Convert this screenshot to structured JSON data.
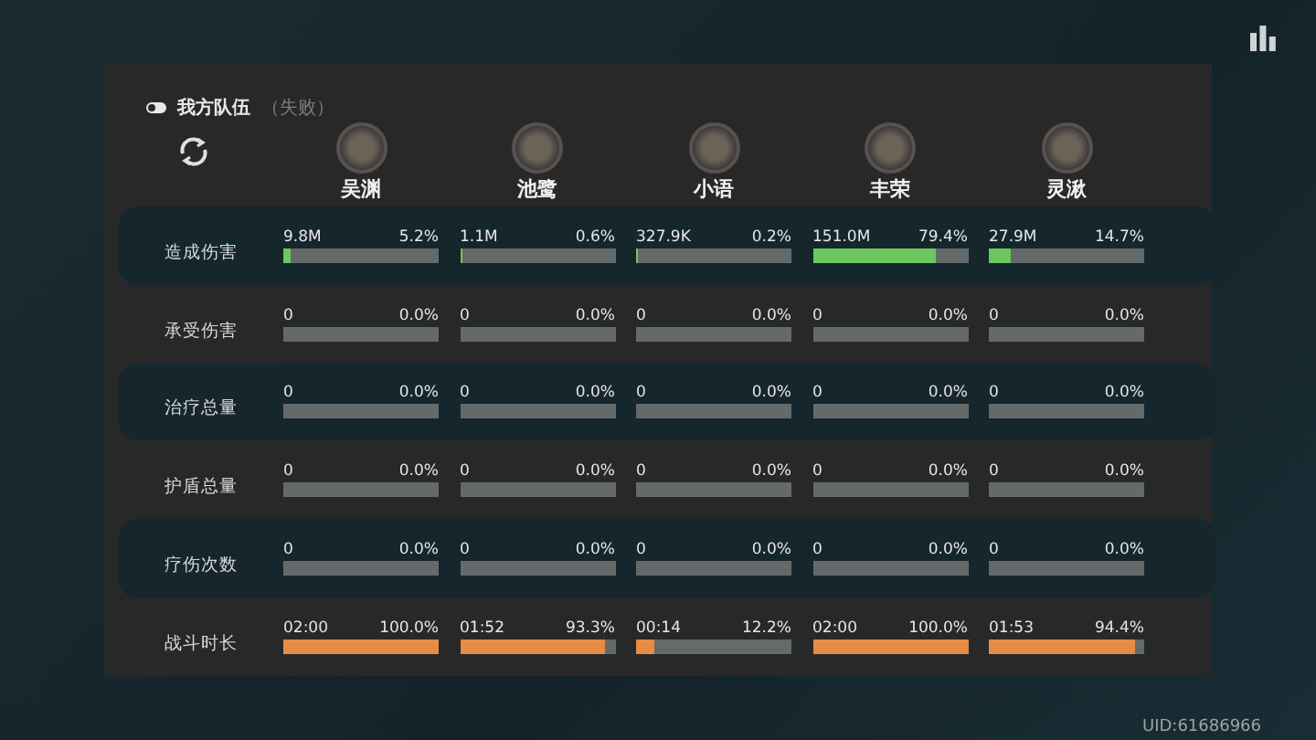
{
  "team": {
    "title": "我方队伍",
    "result": "（失败）"
  },
  "players": [
    {
      "name": "吴渊"
    },
    {
      "name": "池鹭"
    },
    {
      "name": "小语"
    },
    {
      "name": "丰荣"
    },
    {
      "name": "灵湫"
    }
  ],
  "rows": [
    {
      "label": "造成伤害",
      "highlighted": true,
      "color": "#6cc75e",
      "cells": [
        {
          "value": "9.8M",
          "percent": "5.2%",
          "level": 0.052
        },
        {
          "value": "1.1M",
          "percent": "0.6%",
          "level": 0.006
        },
        {
          "value": "327.9K",
          "percent": "0.2%",
          "level": 0.002
        },
        {
          "value": "151.0M",
          "percent": "79.4%",
          "level": 0.794
        },
        {
          "value": "27.9M",
          "percent": "14.7%",
          "level": 0.147
        }
      ]
    },
    {
      "label": "承受伤害",
      "highlighted": false,
      "cells": [
        {
          "value": "0",
          "percent": "0.0%"
        },
        {
          "value": "0",
          "percent": "0.0%"
        },
        {
          "value": "0",
          "percent": "0.0%"
        },
        {
          "value": "0",
          "percent": "0.0%"
        },
        {
          "value": "0",
          "percent": "0.0%"
        }
      ]
    },
    {
      "label": "治疗总量",
      "highlighted": true,
      "cells": [
        {
          "value": "0",
          "percent": "0.0%"
        },
        {
          "value": "0",
          "percent": "0.0%"
        },
        {
          "value": "0",
          "percent": "0.0%"
        },
        {
          "value": "0",
          "percent": "0.0%"
        },
        {
          "value": "0",
          "percent": "0.0%"
        }
      ]
    },
    {
      "label": "护盾总量",
      "highlighted": false,
      "cells": [
        {
          "value": "0",
          "percent": "0.0%"
        },
        {
          "value": "0",
          "percent": "0.0%"
        },
        {
          "value": "0",
          "percent": "0.0%"
        },
        {
          "value": "0",
          "percent": "0.0%"
        },
        {
          "value": "0",
          "percent": "0.0%"
        }
      ]
    },
    {
      "label": "疗伤次数",
      "highlighted": true,
      "cells": [
        {
          "value": "0",
          "percent": "0.0%"
        },
        {
          "value": "0",
          "percent": "0.0%"
        },
        {
          "value": "0",
          "percent": "0.0%"
        },
        {
          "value": "0",
          "percent": "0.0%"
        },
        {
          "value": "0",
          "percent": "0.0%"
        }
      ]
    },
    {
      "label": "战斗时长",
      "highlighted": false,
      "color": "#e58c45",
      "cells": [
        {
          "value": "02:00",
          "percent": "100.0%",
          "level": 1
        },
        {
          "value": "01:52",
          "percent": "93.3%",
          "level": 0.933
        },
        {
          "value": "00:14",
          "percent": "12.2%",
          "level": 0.122
        },
        {
          "value": "02:00",
          "percent": "100.0%",
          "level": 1
        },
        {
          "value": "01:53",
          "percent": "94.4%",
          "level": 0.944
        }
      ]
    }
  ],
  "uid": "UID:61686966"
}
